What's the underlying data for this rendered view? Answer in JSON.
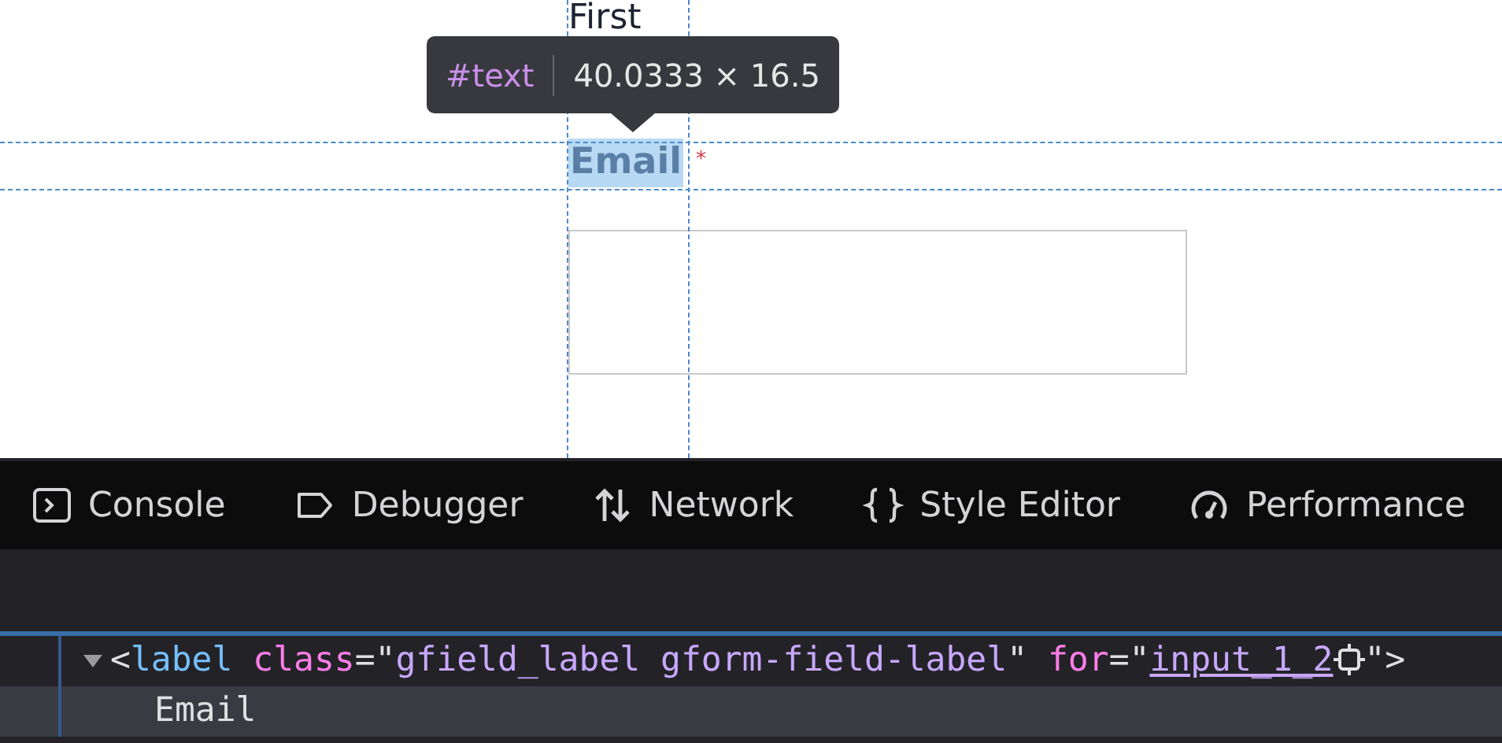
{
  "page": {
    "partial_label": "First",
    "field_label": "Email",
    "required_mark": "*",
    "highlighted": true
  },
  "tooltip": {
    "node": "#text",
    "size": "40.0333 × 16.5"
  },
  "tabs": [
    {
      "kind": "console",
      "label": "Console",
      "selected": false
    },
    {
      "kind": "debugger",
      "label": "Debugger",
      "selected": false
    },
    {
      "kind": "network",
      "label": "Network",
      "selected": false
    },
    {
      "kind": "style",
      "label": "Style Editor",
      "selected": false
    },
    {
      "kind": "performance",
      "label": "Performance",
      "selected": false
    }
  ],
  "markup": [
    {
      "expanded": true,
      "selected": false,
      "tokens": [
        {
          "kind": "punct",
          "text": "<"
        },
        {
          "kind": "tag",
          "text": "label"
        },
        {
          "kind": "attr",
          "text": "class"
        },
        {
          "kind": "punct",
          "text": "=\""
        },
        {
          "kind": "value",
          "text": "gfield_label gform-field-label"
        },
        {
          "kind": "punct",
          "text": "\""
        },
        {
          "kind": "attr",
          "text": "for"
        },
        {
          "kind": "punct",
          "text": "=\""
        },
        {
          "kind": "link",
          "text": "input_1_2"
        },
        {
          "kind": "target"
        },
        {
          "kind": "punct",
          "text": "\">"
        }
      ]
    },
    {
      "selected": true,
      "tokens": [
        {
          "kind": "text",
          "text": "Email"
        }
      ]
    }
  ]
}
